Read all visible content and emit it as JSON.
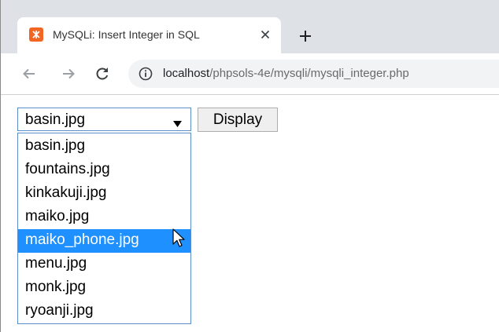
{
  "browser": {
    "tab": {
      "title": "MySQLi: Insert Integer in SQL",
      "close_icon": "close-icon",
      "favicon": "xampp-icon"
    },
    "new_tab_icon": "plus-icon",
    "nav": {
      "back_icon": "arrow-left-icon",
      "forward_icon": "arrow-right-icon",
      "reload_icon": "reload-icon"
    },
    "address": {
      "info_icon": "info-icon",
      "host": "localhost",
      "path": "/phpsols-4e/mysqli/mysqli_integer.php"
    }
  },
  "page": {
    "select": {
      "value": "basin.jpg",
      "options": [
        "basin.jpg",
        "fountains.jpg",
        "kinkakuji.jpg",
        "maiko.jpg",
        "maiko_phone.jpg",
        "menu.jpg",
        "monk.jpg",
        "ryoanji.jpg"
      ],
      "highlighted_index": 4
    },
    "display_button": "Display"
  },
  "colors": {
    "tab_strip": "#dee1e6",
    "highlight": "#1e90ff",
    "favicon": "#f26522",
    "select_border": "#5b8ec9"
  }
}
